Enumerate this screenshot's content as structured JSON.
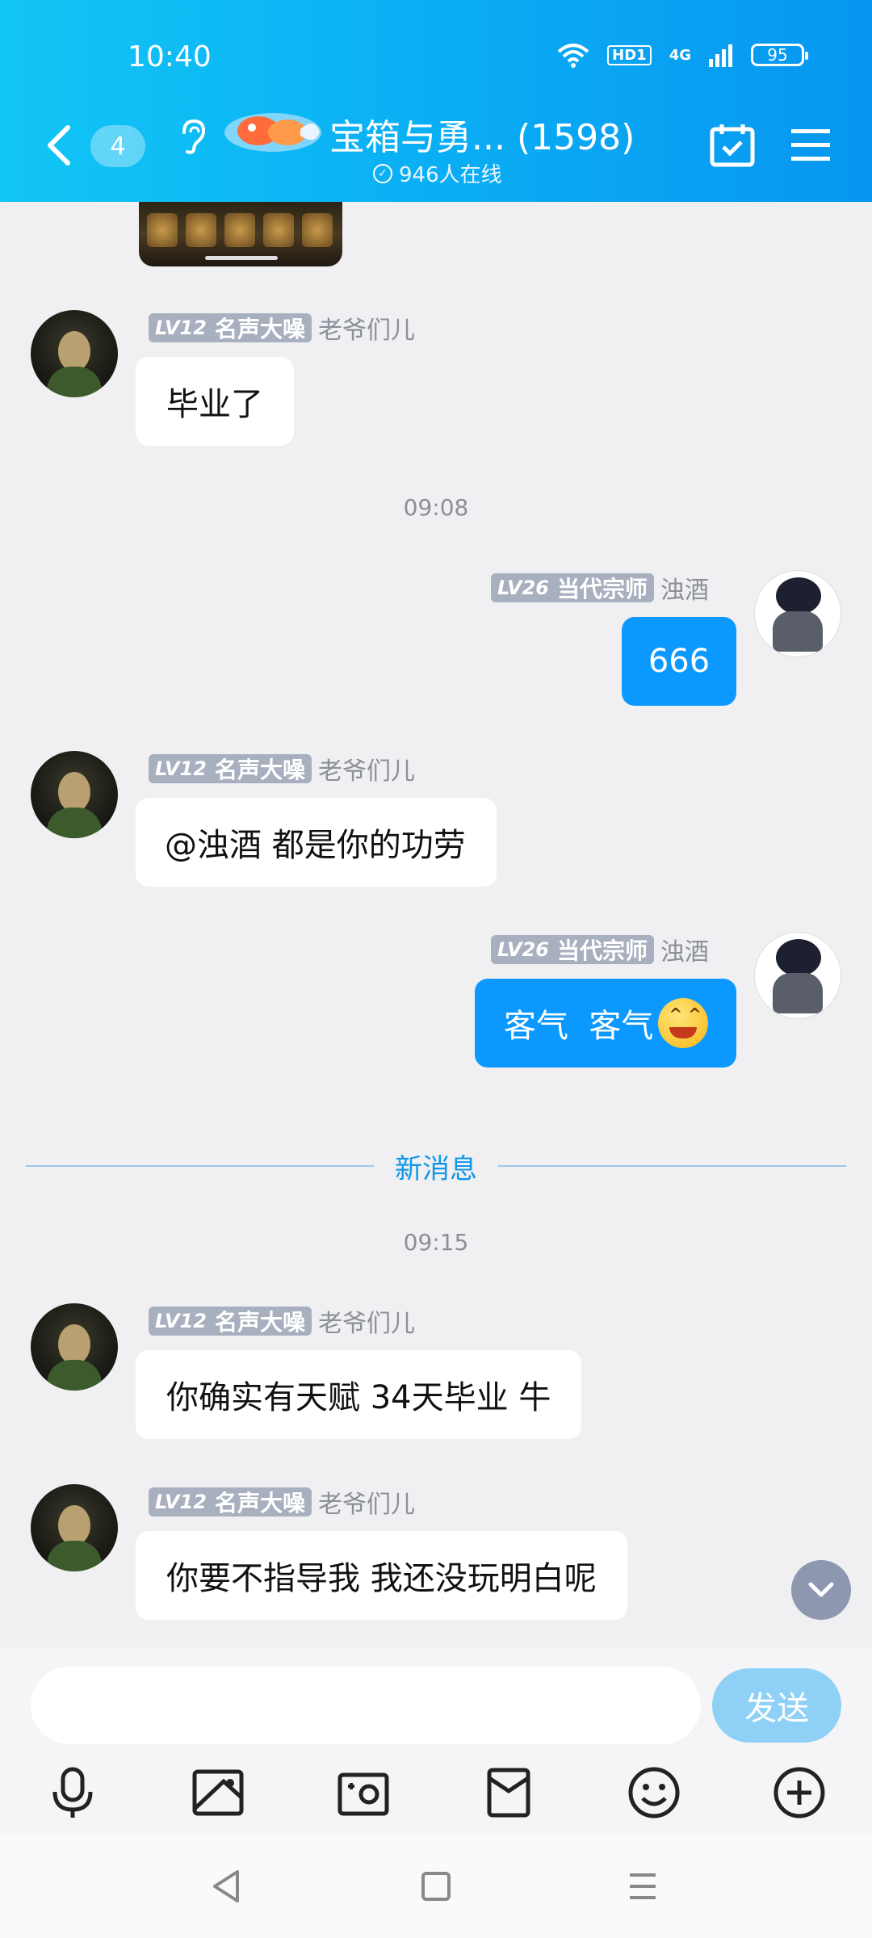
{
  "status_bar": {
    "time": "10:40",
    "network": "4G",
    "hd_label": "HD1",
    "battery": "95"
  },
  "header": {
    "unread_count": "4",
    "group_title": "宝箱与勇... (1598)",
    "online_text": "946人在线"
  },
  "messages": [
    {
      "side": "left",
      "badge_level": "LV12",
      "badge_title": "名声大噪",
      "sender": "老爷们儿",
      "text": "毕业了"
    },
    {
      "type": "time",
      "text": "09:08"
    },
    {
      "side": "right",
      "badge_level": "LV26",
      "badge_title": "当代宗师",
      "sender": "浊酒",
      "text": "666"
    },
    {
      "side": "left",
      "badge_level": "LV12",
      "badge_title": "名声大噪",
      "sender": "老爷们儿",
      "text": "@浊酒 都是你的功劳"
    },
    {
      "side": "right",
      "badge_level": "LV26",
      "badge_title": "当代宗师",
      "sender": "浊酒",
      "text": "客气  客气",
      "emoji": "grin-emoji"
    },
    {
      "type": "divider",
      "text": "新消息"
    },
    {
      "type": "time",
      "text": "09:15"
    },
    {
      "side": "left",
      "badge_level": "LV12",
      "badge_title": "名声大噪",
      "sender": "老爷们儿",
      "text": "你确实有天赋 34天毕业 牛"
    },
    {
      "side": "left",
      "badge_level": "LV12",
      "badge_title": "名声大噪",
      "sender": "老爷们儿",
      "text": "你要不指导我 我还没玩明白呢"
    }
  ],
  "input": {
    "placeholder": "",
    "send_label": "发送"
  },
  "toolbar_icons": [
    "microphone-icon",
    "image-icon",
    "camera-icon",
    "red-packet-icon",
    "emoji-icon",
    "plus-icon"
  ],
  "navbar_icons": [
    "nav-back-icon",
    "nav-home-icon",
    "nav-menu-icon"
  ],
  "colors": {
    "header": "#0aaef4",
    "self_bubble": "#0b99ff",
    "send_button": "#8fd0f7",
    "badge": "#a8b0bf",
    "divider_text": "#1096e8"
  }
}
